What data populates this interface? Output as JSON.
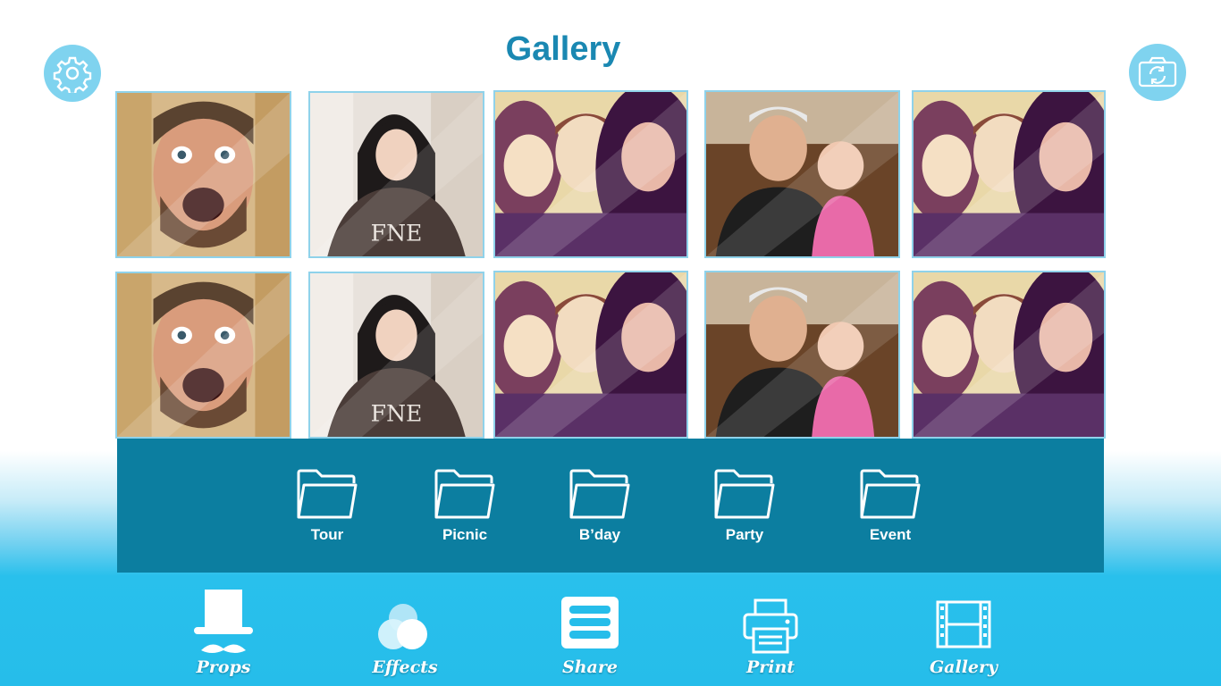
{
  "header": {
    "title": "Gallery",
    "settings_icon": "gear-icon",
    "camera_icon": "camera-switch-icon"
  },
  "gallery": {
    "photos": [
      {
        "subject": "man-surprised"
      },
      {
        "subject": "woman-dark-hair"
      },
      {
        "subject": "three-girls-selfie"
      },
      {
        "subject": "man-with-baby"
      },
      {
        "subject": "three-girls-selfie"
      },
      {
        "subject": "man-surprised"
      },
      {
        "subject": "woman-dark-hair"
      },
      {
        "subject": "three-girls-selfie"
      },
      {
        "subject": "man-with-baby"
      },
      {
        "subject": "three-girls-selfie"
      }
    ]
  },
  "folders": [
    {
      "label": "Tour",
      "icon": "folder-icon"
    },
    {
      "label": "Picnic",
      "icon": "folder-icon"
    },
    {
      "label": "B’day",
      "icon": "folder-icon"
    },
    {
      "label": "Party",
      "icon": "folder-icon"
    },
    {
      "label": "Event",
      "icon": "folder-icon"
    }
  ],
  "nav": [
    {
      "label": "Props",
      "icon": "top-hat-mustache-icon"
    },
    {
      "label": "Effects",
      "icon": "circles-icon"
    },
    {
      "label": "Share",
      "icon": "menu-lines-icon"
    },
    {
      "label": "Print",
      "icon": "printer-icon"
    },
    {
      "label": "Gallery",
      "icon": "film-strip-icon"
    }
  ],
  "colors": {
    "title": "#1a88b2",
    "panel": "#0c7ea0",
    "accent_blue": "#26bdea",
    "round_button": "#7fd3ef",
    "thumb_border": "#8fd2ea"
  }
}
